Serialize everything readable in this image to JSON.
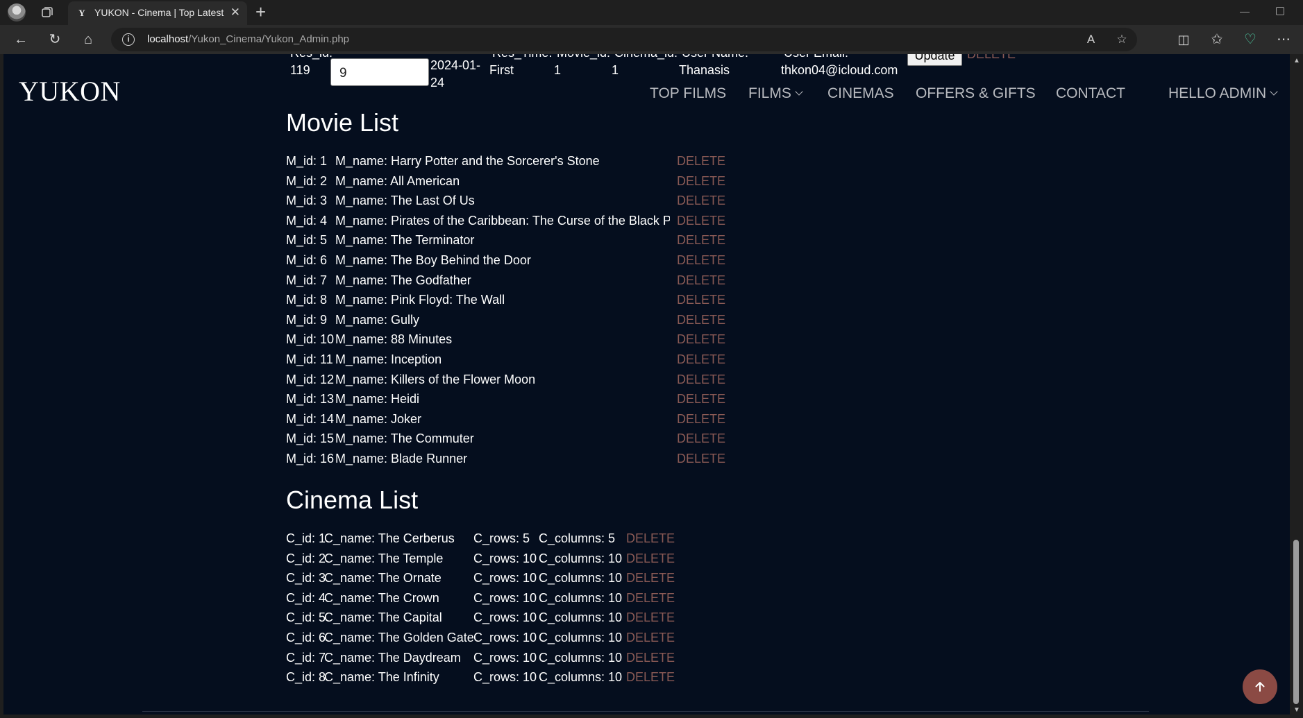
{
  "browser": {
    "tab_title": "YUKON - Cinema | Top Latest Movies",
    "tab_favicon": "Y",
    "url_host": "localhost",
    "url_path": "/Yukon_Cinema/Yukon_Admin.php"
  },
  "header": {
    "logo": "YUKON",
    "nav": {
      "top_films": "TOP FILMS",
      "films": "FILMS",
      "cinemas": "CINEMAS",
      "offers": "OFFERS & GIFTS",
      "contact": "CONTACT",
      "hello": "HELLO ADMIN"
    }
  },
  "reservation_row": {
    "res_id_label": "Res_id:",
    "res_id": "119",
    "seat_label": "_",
    "seat_value": "9",
    "date_line1": "2024-01-",
    "date_line2": "24",
    "res_time_label": "Res_Time:",
    "res_time": "First",
    "movie_id_label": "Movie_id:",
    "movie_id": "1",
    "cinema_id_label": "Cinema_id:",
    "cinema_id": "1",
    "user_name_label": "User Name:",
    "user_name": "Thanasis",
    "user_email_label": "User Email:",
    "user_email": "thkon04@icloud.com",
    "update_label": "Update",
    "delete_label": "DELETE"
  },
  "movie_list": {
    "title": "Movie List",
    "delete_label": "DELETE",
    "items": [
      {
        "id": "M_id: 1",
        "name": "M_name: Harry Potter and the Sorcerer's Stone"
      },
      {
        "id": "M_id: 2",
        "name": "M_name: All American"
      },
      {
        "id": "M_id: 3",
        "name": "M_name: The Last Of Us"
      },
      {
        "id": "M_id: 4",
        "name": "M_name: Pirates of the Caribbean: The Curse of the Black P"
      },
      {
        "id": "M_id: 5",
        "name": "M_name: The Terminator"
      },
      {
        "id": "M_id: 6",
        "name": "M_name: The Boy Behind the Door"
      },
      {
        "id": "M_id: 7",
        "name": "M_name: The Godfather"
      },
      {
        "id": "M_id: 8",
        "name": "M_name: Pink Floyd: The Wall"
      },
      {
        "id": "M_id: 9",
        "name": "M_name: Gully"
      },
      {
        "id": "M_id: 10",
        "name": "M_name: 88 Minutes"
      },
      {
        "id": "M_id: 11",
        "name": "M_name: Inception"
      },
      {
        "id": "M_id: 12",
        "name": "M_name: Killers of the Flower Moon"
      },
      {
        "id": "M_id: 13",
        "name": "M_name: Heidi"
      },
      {
        "id": "M_id: 14",
        "name": "M_name: Joker"
      },
      {
        "id": "M_id: 15",
        "name": "M_name: The Commuter"
      },
      {
        "id": "M_id: 16",
        "name": "M_name: Blade Runner"
      }
    ]
  },
  "cinema_list": {
    "title": "Cinema List",
    "delete_label": "DELETE",
    "items": [
      {
        "id": "C_id: 1",
        "name": "C_name: The Cerberus",
        "rows": "C_rows: 5",
        "cols": "C_columns: 5"
      },
      {
        "id": "C_id: 2",
        "name": "C_name: The Temple",
        "rows": "C_rows: 10",
        "cols": "C_columns: 10"
      },
      {
        "id": "C_id: 3",
        "name": "C_name: The Ornate",
        "rows": "C_rows: 10",
        "cols": "C_columns: 10"
      },
      {
        "id": "C_id: 4",
        "name": "C_name: The Crown",
        "rows": "C_rows: 10",
        "cols": "C_columns: 10"
      },
      {
        "id": "C_id: 5",
        "name": "C_name: The Capital",
        "rows": "C_rows: 10",
        "cols": "C_columns: 10"
      },
      {
        "id": "C_id: 6",
        "name": "C_name: The Golden Gate",
        "rows": "C_rows: 10",
        "cols": "C_columns: 10"
      },
      {
        "id": "C_id: 7",
        "name": "C_name: The Daydream",
        "rows": "C_rows: 10",
        "cols": "C_columns: 10"
      },
      {
        "id": "C_id: 8",
        "name": "C_name: The Infinity",
        "rows": "C_rows: 10",
        "cols": "C_columns: 10"
      }
    ]
  },
  "colors": {
    "page_bg": "#050e1e",
    "delete_link": "#8a5a55",
    "back_to_top": "#8b4a44",
    "nav_text": "#b9bbc0"
  },
  "icons": {
    "back_to_top": "arrow-up-icon"
  }
}
